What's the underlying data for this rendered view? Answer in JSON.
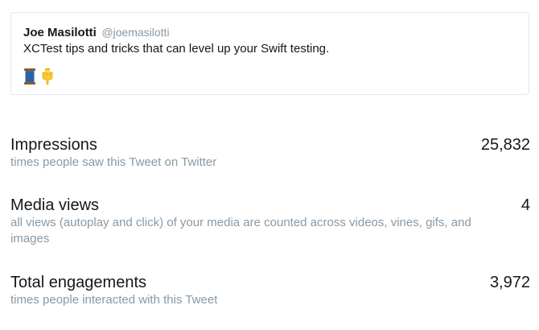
{
  "tweet": {
    "author_name": "Joe Masilotti",
    "author_handle": "@joemasilotti",
    "text": "XCTest tips and tricks that can level up your Swift testing.",
    "emojis": [
      "spool-of-thread-icon",
      "pointing-down-icon"
    ]
  },
  "metrics": [
    {
      "title": "Impressions",
      "value": "25,832",
      "description": "times people saw this Tweet on Twitter"
    },
    {
      "title": "Media views",
      "value": "4",
      "description": "all views (autoplay and click) of your media are counted across videos, vines, gifs, and images"
    },
    {
      "title": "Total engagements",
      "value": "3,972",
      "description": "times people interacted with this Tweet"
    }
  ],
  "colors": {
    "primary_text": "#14171a",
    "secondary_text": "#8899a6",
    "card_border": "#e1e8ed"
  }
}
